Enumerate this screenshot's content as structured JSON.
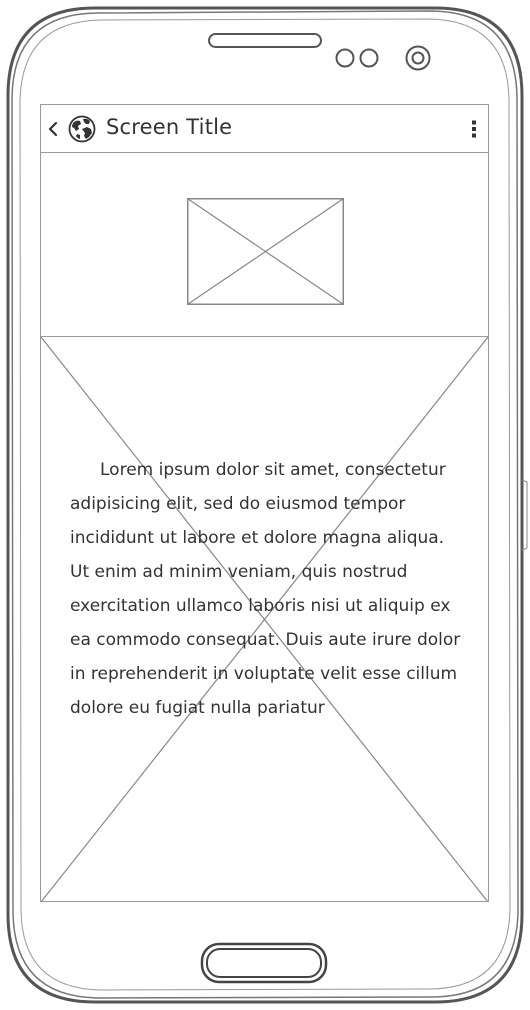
{
  "header": {
    "title": "Screen Title"
  },
  "content": {
    "paragraph": "Lorem ipsum dolor sit amet, consectetur adipisicing elit, sed do eiusmod tempor incididunt ut labore et dolore magna aliqua. Ut enim ad minim veniam, quis nostrud exercitation ullamco laboris nisi ut aliquip ex ea commodo consequat. Duis aute irure dolor in reprehenderit in voluptate velit esse cillum dolore eu fugiat nulla pariatur"
  },
  "icons": {
    "back": "chevron-left-icon",
    "app": "globe-icon",
    "menu": "kebab-menu-icon"
  },
  "colors": {
    "outline": "#9a9a9a",
    "text": "#333333",
    "background": "#ffffff"
  }
}
